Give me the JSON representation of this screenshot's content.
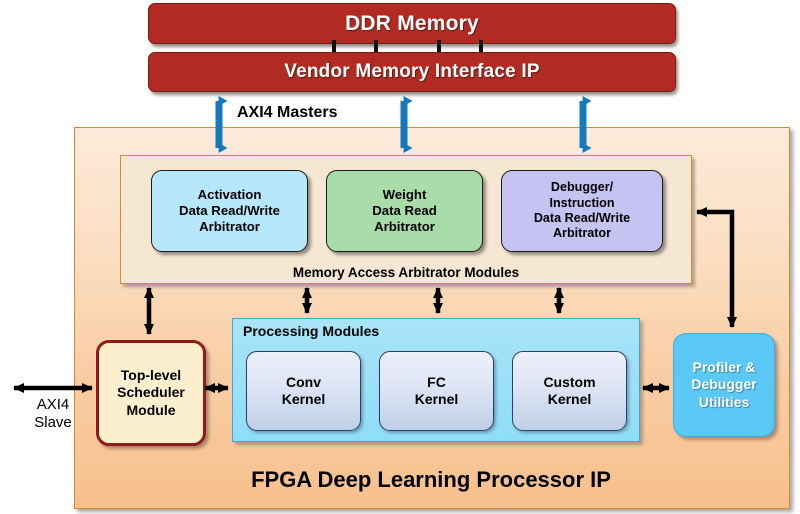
{
  "diagram": {
    "title": "FPGA Deep Learning Processor IP",
    "memory": {
      "ddr": "DDR Memory",
      "vendor_ip": "Vendor Memory Interface IP"
    },
    "interfaces": {
      "masters_label": "AXI4 Masters",
      "slave_label": "AXI4\nSlave",
      "slave_label_line1": "AXI4",
      "slave_label_line2": "Slave"
    },
    "arbitrators": {
      "container_label": "Memory Access Arbitrator Modules",
      "items": [
        {
          "id": "activation",
          "lines": [
            "Activation",
            "Data Read/Write",
            "Arbitrator"
          ],
          "line1": "Activation",
          "line2": "Data Read/Write",
          "line3": "Arbitrator",
          "color": "#B7E7FB"
        },
        {
          "id": "weight",
          "lines": [
            "Weight",
            "Data Read",
            "Arbitrator"
          ],
          "line1": "Weight",
          "line2": "Data Read",
          "line3": "Arbitrator",
          "color": "#A8DCA8"
        },
        {
          "id": "debugger",
          "lines": [
            "Debugger/",
            "Instruction",
            "Data Read/Write",
            "Arbitrator"
          ],
          "line1": "Debugger/",
          "line2": "Instruction",
          "line3": "Data Read/Write",
          "line4": "Arbitrator",
          "color": "#C6C2F2"
        }
      ]
    },
    "scheduler": {
      "line1": "Top-level",
      "line2": "Scheduler",
      "line3": "Module"
    },
    "processing": {
      "container_label": "Processing Modules",
      "kernels": [
        {
          "id": "conv",
          "line1": "Conv",
          "line2": "Kernel"
        },
        {
          "id": "fc",
          "line1": "FC",
          "line2": "Kernel"
        },
        {
          "id": "custom",
          "line1": "Custom",
          "line2": "Kernel"
        }
      ]
    },
    "profiler": {
      "line1": "Profiler &",
      "line2": "Debugger",
      "line3": "Utilities"
    },
    "colors": {
      "memory_red": "#B22B22",
      "panel_orange_light": "#FCEBDA",
      "panel_orange_dark": "#F7C08D",
      "panel_border": "#D98A2B",
      "arbitrator_bg": "#F6E7D2",
      "processing_bg": "#8FDDF8",
      "profiler_blue": "#5BC8F5",
      "scheduler_cream": "#FCEFCE",
      "scheduler_border": "#8E1B17",
      "axi_arrow_blue": "#1479BE",
      "arrow_black": "#000000"
    }
  }
}
